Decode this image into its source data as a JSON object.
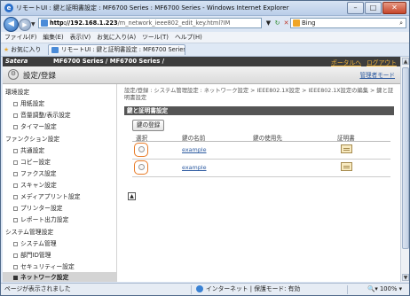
{
  "window": {
    "title": "リモートUI : 鍵と証明書設定 : MF6700 Series : MF6700 Series - Windows Internet Explorer",
    "min": "–",
    "max": "□",
    "close": "✕"
  },
  "address": {
    "host": "http://192.168.1.223",
    "path": "/m_network_ieee802_edit_key.html?IM",
    "search_engine": "Bing"
  },
  "menu": [
    "ファイル(F)",
    "編集(E)",
    "表示(V)",
    "お気に入り(A)",
    "ツール(T)",
    "ヘルプ(H)"
  ],
  "favorites": {
    "label": "お気に入り",
    "tab_title": "リモートUI : 鍵と証明書設定 : MF6700 Series..."
  },
  "header": {
    "brand": "Satera",
    "model": "MF6700 Series / MF6700 Series /",
    "link_portal": "ポータルへ",
    "link_logout": "ログアウト",
    "heading": "設定/登録",
    "manager_mode": "管理者モード"
  },
  "nav": {
    "sec1": "環境設定",
    "sec1_items": [
      "用紙設定",
      "音量調整/表示設定",
      "タイマー設定"
    ],
    "sec2": "ファンクション設定",
    "sec2_items": [
      "共通設定",
      "コピー設定",
      "ファクス設定",
      "スキャン設定",
      "メディアプリント設定",
      "プリンター設定",
      "レポート出力設定"
    ],
    "sec3": "システム管理設定",
    "sec3_items": [
      "システム管理",
      "部門ID管理",
      "セキュリティー設定",
      "ネットワーク設定"
    ]
  },
  "main": {
    "breadcrumb": "設定/登録 : システム管理設定 : ネットワーク設定 > IEEE802.1X設定 > IEEE802.1X設定の編集 > 鍵と証明書設定",
    "section_title": "鍵と証明書設定",
    "register_button": "鍵の登録",
    "columns": [
      "選択",
      "鍵の名前",
      "鍵の使用先",
      "証明書"
    ],
    "rows": [
      {
        "key_name": "example",
        "usage": ""
      },
      {
        "key_name": "example",
        "usage": ""
      }
    ]
  },
  "status": {
    "left": "ページが表示されました",
    "zone": "インターネット | 保護モード: 有効",
    "zoom": "100%"
  }
}
